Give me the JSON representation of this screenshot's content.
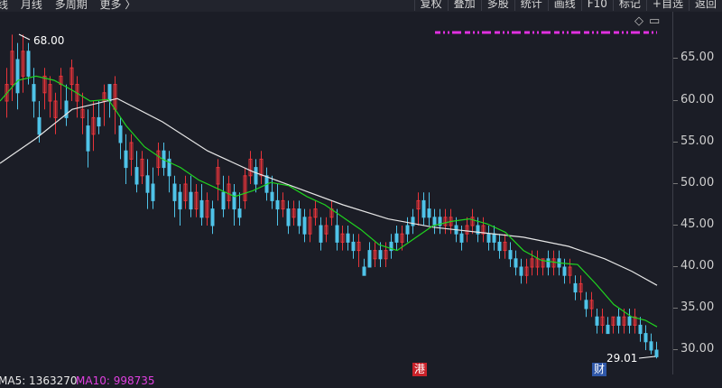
{
  "toolbar": {
    "left_items": [
      "线",
      "月线",
      "多周期",
      "更多 〉"
    ],
    "right_items": [
      "复权",
      "叠加",
      "多股",
      "统计",
      "画线",
      "F10",
      "标记",
      "+自选",
      "返回"
    ]
  },
  "price_axis": {
    "ticks": [
      "65.00",
      "60.00",
      "55.00",
      "50.00",
      "45.00",
      "40.00",
      "35.00",
      "30.00"
    ]
  },
  "annotations": {
    "high": "68.00",
    "low": "29.01"
  },
  "badges": {
    "hk": "港",
    "fin": "财"
  },
  "indicator": {
    "ma5": "MA5: 1363270",
    "ma10": "MA10: 998735"
  },
  "colors": {
    "up": "#e8343a",
    "down": "#4fc3e8",
    "ma_green": "#1fd41f",
    "ma_white": "#e6e6e6",
    "magenta": "#e030e0",
    "badge_bg": "#c9222a",
    "fin_bg": "#2f57a8"
  },
  "chart_data": {
    "type": "candlestick",
    "ylim": [
      28,
      70
    ],
    "ma_white": [
      [
        0,
        52.5
      ],
      [
        40,
        55.5
      ],
      [
        80,
        59
      ],
      [
        130,
        60.3
      ],
      [
        180,
        57.5
      ],
      [
        230,
        54
      ],
      [
        280,
        51.5
      ],
      [
        330,
        49.5
      ],
      [
        380,
        47.5
      ],
      [
        430,
        45.8
      ],
      [
        480,
        44.8
      ],
      [
        530,
        44.2
      ],
      [
        580,
        43.6
      ],
      [
        630,
        42.5
      ],
      [
        670,
        41
      ],
      [
        700,
        39.5
      ],
      [
        728,
        37.8
      ]
    ],
    "ma_green": [
      [
        0,
        60
      ],
      [
        20,
        62.5
      ],
      [
        40,
        63
      ],
      [
        60,
        62.5
      ],
      [
        80,
        61.3
      ],
      [
        100,
        60
      ],
      [
        120,
        60.2
      ],
      [
        140,
        57
      ],
      [
        160,
        54.5
      ],
      [
        180,
        53
      ],
      [
        200,
        52
      ],
      [
        220,
        50.5
      ],
      [
        240,
        49.5
      ],
      [
        260,
        48.5
      ],
      [
        280,
        49.2
      ],
      [
        300,
        50.2
      ],
      [
        320,
        49.8
      ],
      [
        340,
        48.5
      ],
      [
        360,
        47.5
      ],
      [
        380,
        46
      ],
      [
        400,
        44.5
      ],
      [
        420,
        42.7
      ],
      [
        440,
        42
      ],
      [
        460,
        43.5
      ],
      [
        480,
        45
      ],
      [
        500,
        45.5
      ],
      [
        520,
        45.8
      ],
      [
        540,
        45.2
      ],
      [
        560,
        44.2
      ],
      [
        580,
        42
      ],
      [
        600,
        40.8
      ],
      [
        620,
        40.5
      ],
      [
        640,
        40.3
      ],
      [
        660,
        38
      ],
      [
        680,
        35.5
      ],
      [
        700,
        34
      ],
      [
        715,
        33.6
      ],
      [
        728,
        32.8
      ]
    ],
    "candles": [
      [
        6,
        60,
        62,
        58,
        64
      ],
      [
        12,
        62,
        66,
        60,
        68
      ],
      [
        18,
        65,
        61,
        59,
        67
      ],
      [
        24,
        63,
        66,
        61,
        68
      ],
      [
        30,
        66,
        63,
        62,
        67
      ],
      [
        36,
        62,
        60,
        58,
        64
      ],
      [
        42,
        58,
        56,
        55,
        60
      ],
      [
        48,
        61,
        63,
        59,
        64
      ],
      [
        54,
        60,
        62,
        58,
        63
      ],
      [
        60,
        58,
        60,
        56,
        61
      ],
      [
        66,
        62,
        63,
        59,
        64
      ],
      [
        72,
        60,
        58,
        57,
        62
      ],
      [
        78,
        62,
        64,
        60,
        65
      ],
      [
        84,
        60,
        62,
        58,
        63
      ],
      [
        90,
        58,
        59,
        56,
        61
      ],
      [
        96,
        57,
        54,
        52,
        59
      ],
      [
        102,
        56,
        58,
        54,
        60
      ],
      [
        108,
        58,
        57,
        56,
        60
      ],
      [
        114,
        60,
        61,
        57,
        62
      ],
      [
        120,
        62,
        60,
        58,
        62
      ],
      [
        126,
        59,
        62,
        56,
        63
      ],
      [
        132,
        57,
        55,
        53,
        58
      ],
      [
        138,
        54,
        52,
        50,
        56
      ],
      [
        144,
        53,
        55,
        51,
        56
      ],
      [
        150,
        52,
        50,
        49,
        54
      ],
      [
        156,
        51,
        53,
        50,
        54
      ],
      [
        162,
        51,
        49,
        47,
        53
      ],
      [
        168,
        50,
        48,
        47,
        52
      ],
      [
        174,
        52,
        54,
        51,
        55
      ],
      [
        180,
        54,
        52,
        51,
        55
      ],
      [
        186,
        53,
        51,
        49,
        54
      ],
      [
        192,
        50,
        48,
        46,
        51
      ],
      [
        198,
        49,
        47,
        45,
        50
      ],
      [
        204,
        48,
        50,
        47,
        51
      ],
      [
        210,
        49,
        47,
        46,
        51
      ],
      [
        216,
        47,
        49,
        46,
        50
      ],
      [
        222,
        48,
        46,
        45,
        50
      ],
      [
        228,
        46,
        48,
        45,
        49
      ],
      [
        234,
        47,
        45,
        44,
        48
      ],
      [
        240,
        50,
        52,
        48,
        53
      ],
      [
        246,
        49,
        47,
        46,
        51
      ],
      [
        252,
        48,
        50,
        47,
        51
      ],
      [
        258,
        49,
        47,
        45,
        50
      ],
      [
        264,
        47,
        46,
        45,
        49
      ],
      [
        270,
        48,
        51,
        47,
        52
      ],
      [
        276,
        51,
        53,
        50,
        54
      ],
      [
        282,
        52,
        50,
        49,
        53
      ],
      [
        288,
        51,
        53,
        50,
        54
      ],
      [
        294,
        51,
        49,
        48,
        52
      ],
      [
        300,
        49,
        48,
        47,
        51
      ],
      [
        306,
        48,
        47,
        45,
        50
      ],
      [
        312,
        47,
        48,
        46,
        49
      ],
      [
        318,
        47,
        45,
        44,
        48
      ],
      [
        324,
        46,
        47,
        45,
        48
      ],
      [
        330,
        47,
        45,
        44,
        48
      ],
      [
        336,
        46,
        44,
        43,
        47
      ],
      [
        342,
        44,
        46,
        43,
        47
      ],
      [
        348,
        46,
        47,
        45,
        48
      ],
      [
        354,
        45,
        43,
        42,
        46
      ],
      [
        360,
        44,
        45,
        43,
        46
      ],
      [
        366,
        46,
        47,
        45,
        48
      ],
      [
        372,
        45,
        43,
        42,
        47
      ],
      [
        378,
        43,
        44,
        42,
        45
      ],
      [
        384,
        44,
        43,
        42,
        45
      ],
      [
        390,
        43,
        42,
        41,
        44
      ],
      [
        396,
        42,
        43,
        40,
        44
      ],
      [
        402,
        40,
        39,
        39,
        41
      ],
      [
        408,
        42,
        40,
        40,
        43
      ],
      [
        414,
        41,
        42,
        40,
        43
      ],
      [
        420,
        42,
        41,
        40,
        43
      ],
      [
        426,
        41,
        42,
        40,
        43
      ],
      [
        432,
        43,
        42,
        41,
        44
      ],
      [
        438,
        44,
        43,
        42,
        45
      ],
      [
        444,
        43,
        44,
        42,
        45
      ],
      [
        450,
        45,
        44,
        43,
        46
      ],
      [
        456,
        46,
        45,
        44,
        47
      ],
      [
        462,
        47,
        48,
        45,
        49
      ],
      [
        468,
        48,
        46,
        45,
        49
      ],
      [
        474,
        47,
        46,
        45,
        49
      ],
      [
        480,
        46,
        45,
        44,
        47
      ],
      [
        486,
        46,
        45,
        44,
        47
      ],
      [
        492,
        45,
        46,
        44,
        47
      ],
      [
        498,
        45,
        46,
        44,
        47
      ],
      [
        504,
        45,
        44,
        43,
        46
      ],
      [
        510,
        44,
        43,
        42,
        45
      ],
      [
        516,
        44,
        45,
        43,
        46
      ],
      [
        522,
        45,
        46,
        44,
        47
      ],
      [
        528,
        45,
        44,
        43,
        46
      ],
      [
        534,
        44,
        45,
        43,
        46
      ],
      [
        540,
        44,
        43,
        42,
        45
      ],
      [
        546,
        44,
        43,
        42,
        45
      ],
      [
        552,
        43,
        42,
        41,
        44
      ],
      [
        558,
        42,
        43,
        41,
        44
      ],
      [
        564,
        42,
        41,
        40,
        43
      ],
      [
        570,
        41,
        40,
        39,
        42
      ],
      [
        576,
        40,
        39,
        38,
        41
      ],
      [
        582,
        39,
        40,
        38,
        41
      ],
      [
        588,
        40,
        41,
        39,
        42
      ],
      [
        594,
        40,
        41,
        39,
        42
      ],
      [
        600,
        40,
        41,
        39,
        41
      ],
      [
        606,
        41,
        40,
        39,
        42
      ],
      [
        612,
        40,
        41,
        39,
        42
      ],
      [
        618,
        41,
        40,
        39,
        42
      ],
      [
        624,
        40,
        39,
        38,
        41
      ],
      [
        630,
        39,
        40,
        38,
        41
      ],
      [
        636,
        38,
        37,
        36,
        39
      ],
      [
        642,
        37,
        38,
        36,
        39
      ],
      [
        648,
        36,
        35,
        34,
        37
      ],
      [
        654,
        35,
        36,
        34,
        37
      ],
      [
        660,
        34,
        33,
        32,
        35
      ],
      [
        666,
        33,
        34,
        32,
        35
      ],
      [
        672,
        33,
        32,
        32,
        34
      ],
      [
        678,
        33,
        34,
        32,
        34
      ],
      [
        684,
        34,
        33,
        32,
        35
      ],
      [
        690,
        33,
        34,
        32,
        35
      ],
      [
        696,
        34,
        33,
        32,
        35
      ],
      [
        702,
        33,
        34,
        32,
        35
      ],
      [
        708,
        33,
        32,
        31,
        34
      ],
      [
        714,
        32,
        31,
        30,
        33
      ],
      [
        720,
        31,
        30,
        29.5,
        32
      ],
      [
        726,
        30,
        29.2,
        29,
        31
      ]
    ]
  }
}
